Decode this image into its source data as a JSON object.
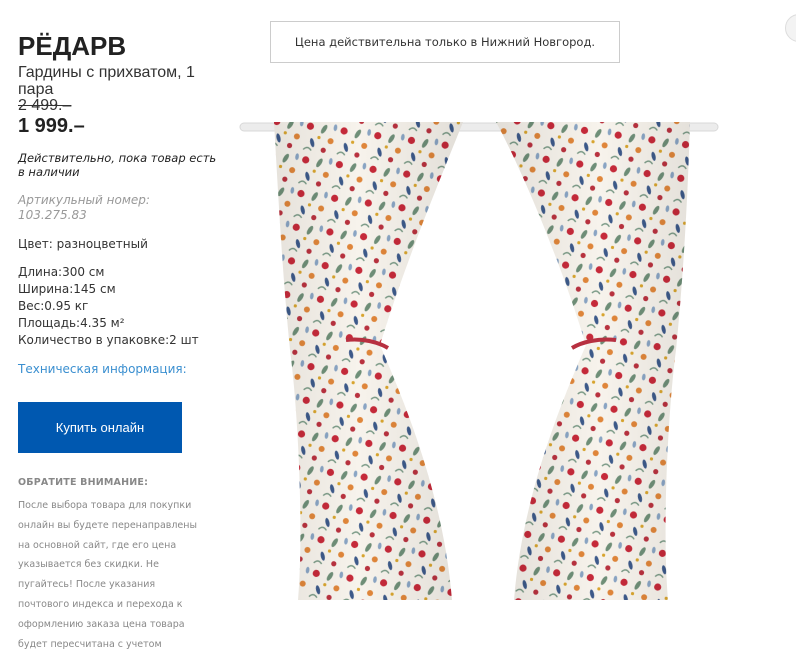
{
  "product": {
    "title": "РЁДАРВ",
    "subtitle": "Гардины с прихватом, 1 пара",
    "old_price": "2 499.–",
    "price": "1 999.–",
    "availability": "Действительно, пока товар есть в наличии",
    "article": "Артикульный номер: 103.275.83",
    "color": "Цвет: разноцветный",
    "specs": [
      "Длина:300 см",
      "Ширина:145 см",
      "Вес:0.95 кг",
      "Площадь:4.35 м²",
      "Количество в упаковке:2 шт"
    ],
    "tech_link": "Техническая информация:",
    "buy_label": "Купить онлайн"
  },
  "notice": {
    "heading": "ОБРАТИТЕ ВНИМАНИЕ:",
    "text": "После выбора товара для покупки онлайн вы будете перенаправлены на основной сайт, где его цена указывается без скидки. Не пугайтесь! После указания почтового индекса и перехода к оформлению заказа цена товара будет пересчитана с учетом"
  },
  "city_notice": "Цена действительна только в Нижний Новгород.",
  "colors": {
    "accent": "#0058b0",
    "link": "#3a8fd0"
  }
}
